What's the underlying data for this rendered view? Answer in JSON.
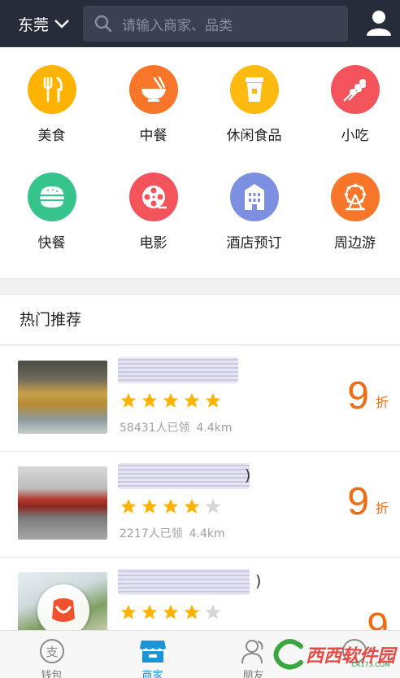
{
  "header": {
    "city": "东莞",
    "search_placeholder": "请输入商家、品类"
  },
  "categories": [
    {
      "label": "美食",
      "icon": "fork-knife-icon",
      "color": "#ffb300"
    },
    {
      "label": "中餐",
      "icon": "noodle-bowl-icon",
      "color": "#f7762a"
    },
    {
      "label": "休闲食品",
      "icon": "drink-cup-icon",
      "color": "#ffba10"
    },
    {
      "label": "小吃",
      "icon": "skewer-icon",
      "color": "#f3535b"
    },
    {
      "label": "快餐",
      "icon": "burger-icon",
      "color": "#36c48c"
    },
    {
      "label": "电影",
      "icon": "film-reel-icon",
      "color": "#f3535b"
    },
    {
      "label": "酒店预订",
      "icon": "hotel-icon",
      "color": "#7d8fe0"
    },
    {
      "label": "周边游",
      "icon": "ferris-wheel-icon",
      "color": "#f7762a"
    }
  ],
  "section": {
    "title": "热门推荐"
  },
  "recommendations": [
    {
      "name_suffix": "",
      "rating": 5,
      "claimed": "58431人已领",
      "distance": "4.4km",
      "discount": "9",
      "discount_unit": "折"
    },
    {
      "name_suffix": ")",
      "rating": 4,
      "claimed": "2217人已领",
      "distance": "4.4km",
      "discount": "9",
      "discount_unit": "折"
    },
    {
      "name_suffix": ")",
      "rating": 4,
      "claimed": "",
      "distance": "",
      "discount": "9",
      "discount_unit": ""
    }
  ],
  "tabs": [
    {
      "label": "钱包",
      "icon": "wallet-icon"
    },
    {
      "label": "商家",
      "icon": "store-icon",
      "active": true
    },
    {
      "label": "朋友",
      "icon": "friends-icon"
    },
    {
      "label": "",
      "icon": "more-icon"
    }
  ],
  "watermark": {
    "text": "西西软件园",
    "sub": "CR173.COM"
  },
  "colors": {
    "header_bg": "#262c3a",
    "accent_orange": "#f06b12",
    "star": "#ffb300",
    "tab_active": "#1a95d8"
  }
}
